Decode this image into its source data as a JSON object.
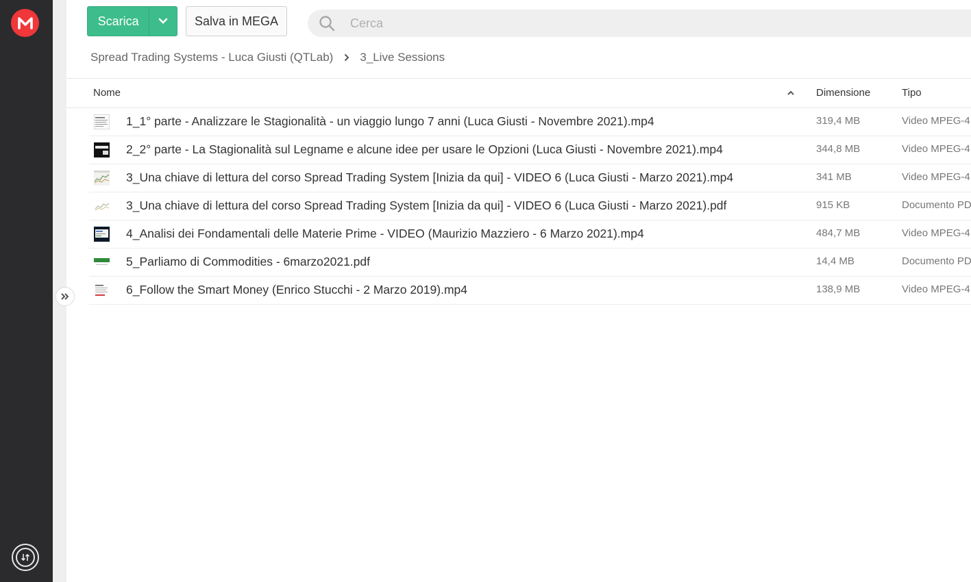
{
  "app": {
    "logo_icon": "mega-logo-icon",
    "transfer_icon": "transfer-manager-icon",
    "accent_color": "#3dbd8b",
    "brand_color": "#f0373a"
  },
  "toolbar": {
    "download_label": "Scarica",
    "save_label": "Salva in MEGA",
    "search_placeholder": "Cerca"
  },
  "breadcrumb": {
    "items": [
      "Spread Trading Systems - Luca Giusti (QTLab)",
      "3_Live Sessions"
    ]
  },
  "table": {
    "headers": {
      "name": "Nome",
      "size": "Dimensione",
      "type": "Tipo"
    },
    "rows": [
      {
        "name": "1_1° parte - Analizzare le Stagionalità - un viaggio lungo 7 anni (Luca Giusti - Novembre 2021).mp4",
        "size": "319,4 MB",
        "type": "Video MPEG-4",
        "thumb": "doc-light"
      },
      {
        "name": "2_2° parte - La Stagionalità sul Legname e alcune idee per usare le Opzioni (Luca Giusti - Novembre 2021).mp4",
        "size": "344,8 MB",
        "type": "Video MPEG-4",
        "thumb": "dark"
      },
      {
        "name": "3_Una chiave di lettura del corso Spread Trading System [Inizia da qui] - VIDEO 6 (Luca Giusti - Marzo 2021).mp4",
        "size": "341 MB",
        "type": "Video MPEG-4",
        "thumb": "chart"
      },
      {
        "name": "3_Una chiave di lettura del corso Spread Trading System [Inizia da qui] - VIDEO 6 (Luca Giusti - Marzo 2021).pdf",
        "size": "915 KB",
        "type": "Documento PDF",
        "thumb": "chart-light"
      },
      {
        "name": "4_Analisi dei Fondamentali delle Materie Prime - VIDEO (Maurizio Mazziero - 6 Marzo 2021).mp4",
        "size": "484,7 MB",
        "type": "Video MPEG-4",
        "thumb": "screen"
      },
      {
        "name": "5_Parliamo di Commodities - 6marzo2021.pdf",
        "size": "14,4 MB",
        "type": "Documento PDF",
        "thumb": "green"
      },
      {
        "name": "6_Follow the Smart Money (Enrico Stucchi - 2 Marzo 2019).mp4",
        "size": "138,9 MB",
        "type": "Video MPEG-4",
        "thumb": "doc-red"
      }
    ]
  }
}
